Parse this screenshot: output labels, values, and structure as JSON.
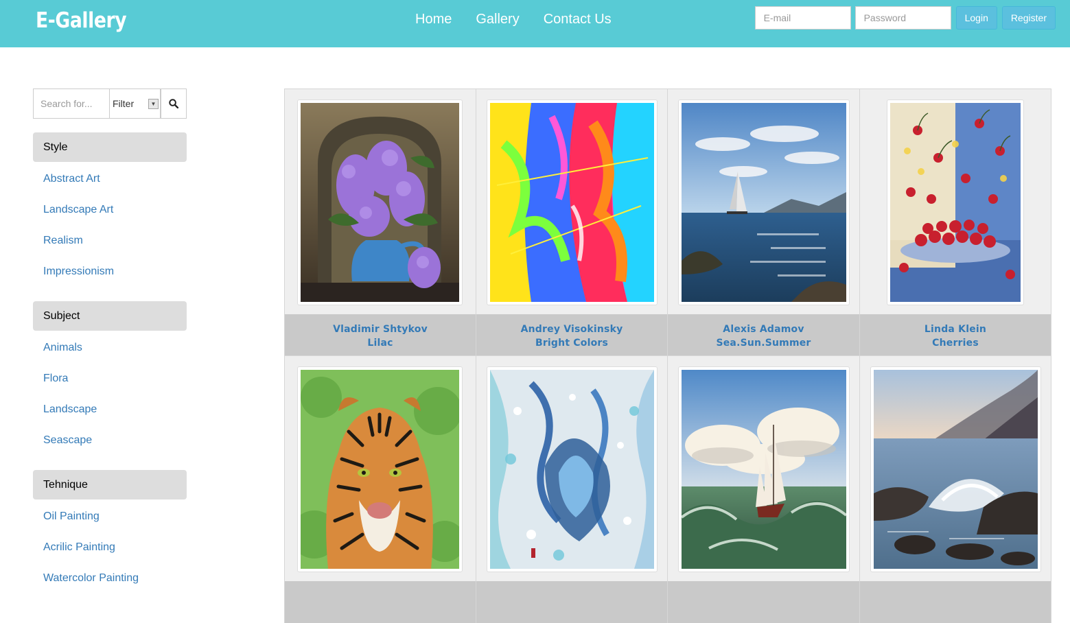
{
  "brand": "E-Gallery",
  "nav": {
    "links": [
      "Home",
      "Gallery",
      "Contact Us"
    ],
    "email_placeholder": "E-mail",
    "password_placeholder": "Password",
    "login_label": "Login",
    "register_label": "Register"
  },
  "sidebar": {
    "search_placeholder": "Search for...",
    "filter_value": "Filter",
    "sections": [
      {
        "title": "Style",
        "items": [
          "Abstract Art",
          "Landscape Art",
          "Realism",
          "Impressionism"
        ]
      },
      {
        "title": "Subject",
        "items": [
          "Animals",
          "Flora",
          "Landscape",
          "Seascape"
        ]
      },
      {
        "title": "Tehnique",
        "items": [
          "Oil Painting",
          "Acrilic Painting",
          "Watercolor Painting"
        ]
      }
    ]
  },
  "gallery": [
    {
      "artist": "Vladimir Shtykov",
      "title": "Lilac"
    },
    {
      "artist": "Andrey Visokinsky",
      "title": "Bright Colors"
    },
    {
      "artist": "Alexis Adamov",
      "title": "Sea.Sun.Summer"
    },
    {
      "artist": "Linda Klein",
      "title": "Cherries"
    },
    {
      "artist": "",
      "title": ""
    },
    {
      "artist": "",
      "title": ""
    },
    {
      "artist": "",
      "title": ""
    },
    {
      "artist": "",
      "title": ""
    }
  ],
  "colors": {
    "navbar": "#58cbd5",
    "button": "#5bc0de",
    "link": "#337ab7",
    "section_bg": "#dddddd",
    "caption_bg": "#c9c9c9"
  },
  "icons": {
    "search": "search-icon",
    "dropdown": "chevron-down-icon"
  }
}
